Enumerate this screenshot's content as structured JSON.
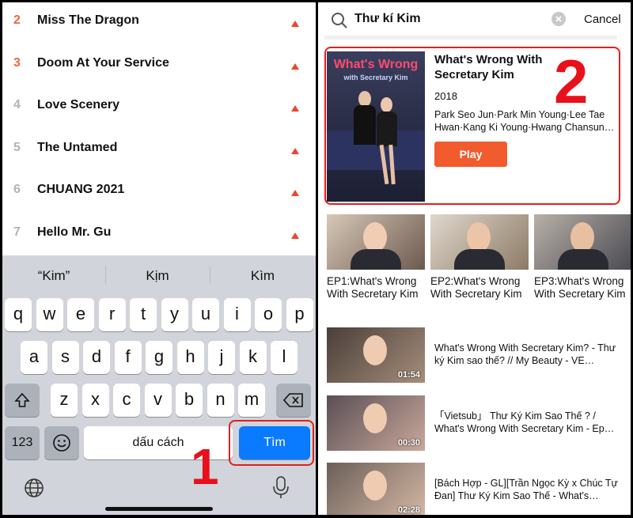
{
  "rank_list": [
    {
      "rank": "2",
      "title": "Miss The Dragon",
      "hot": true
    },
    {
      "rank": "3",
      "title": "Doom At Your Service",
      "hot": true
    },
    {
      "rank": "4",
      "title": "Love Scenery",
      "hot": false
    },
    {
      "rank": "5",
      "title": "The Untamed",
      "hot": false
    },
    {
      "rank": "6",
      "title": "CHUANG 2021",
      "hot": false
    },
    {
      "rank": "7",
      "title": "Hello Mr. Gu",
      "hot": false
    }
  ],
  "keyboard": {
    "suggestions": [
      "“Kim”",
      "Kịm",
      "Kìm"
    ],
    "row1": [
      "q",
      "w",
      "e",
      "r",
      "t",
      "y",
      "u",
      "i",
      "o",
      "p"
    ],
    "row2": [
      "a",
      "s",
      "d",
      "f",
      "g",
      "h",
      "j",
      "k",
      "l"
    ],
    "row3": [
      "z",
      "x",
      "c",
      "v",
      "b",
      "n",
      "m"
    ],
    "numbers_label": "123",
    "space_label": "dấu cách",
    "return_label": "Tìm"
  },
  "annotations": {
    "step1": "1",
    "step2": "2"
  },
  "colors": {
    "accent": "#f25b2e",
    "annotation_red": "#e8101a",
    "return_key": "#0a7aff"
  },
  "search": {
    "query": "Thư kí Kim",
    "cancel_label": "Cancel"
  },
  "featured": {
    "poster_title": "What's Wrong",
    "poster_subtitle": "with Secretary Kim",
    "title": "What's Wrong With Secretary Kim",
    "year": "2018",
    "cast": "Park Seo Jun·Park Min Young·Lee Tae Hwan·Kang Ki Young·Hwang Chansun…",
    "play_label": "Play"
  },
  "episodes": [
    {
      "label": "EP1:What's Wrong With Secretary Kim"
    },
    {
      "label": "EP2:What's Wrong With Secretary Kim"
    },
    {
      "label": "EP3:What's Wrong With Secretary Kim"
    }
  ],
  "videos": [
    {
      "title": "What's Wrong With Secretary Kim? - Thư ký Kim sao thế? // My Beauty - VE…",
      "duration": "01:54"
    },
    {
      "title": "「Vietsub」 Thư Ký Kim Sao Thế ? / What's Wrong With Secretary Kim - Ep…",
      "duration": "00:30"
    },
    {
      "title": "[Bách Hợp - GL][Trần Ngọc Kỳ x Chúc Tự Đan] Thư Ký Kim Sao Thế - What's…",
      "duration": "02:28"
    }
  ]
}
